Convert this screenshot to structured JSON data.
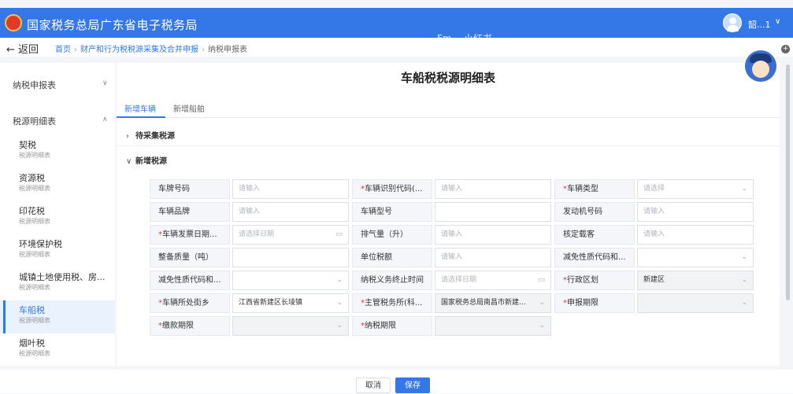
{
  "header": {
    "title": "国家税务总局广东省电子税务局",
    "user": "韶...1",
    "ghost_text": "Fm··· 小红书"
  },
  "nav": {
    "back": "返回",
    "crumbs": [
      "首页",
      "财产和行为税税源采集及合并申报",
      "纳税申报表"
    ]
  },
  "sidebar": {
    "groups": [
      {
        "label": "纳税申报表",
        "chevron": "∨"
      },
      {
        "label": "税源明细表",
        "chevron": "∧"
      }
    ],
    "items": [
      {
        "name": "契税",
        "sub": "税源明细表"
      },
      {
        "name": "资源税",
        "sub": "税源明细表"
      },
      {
        "name": "印花税",
        "sub": "税源明细表"
      },
      {
        "name": "环境保护税",
        "sub": "税源明细表"
      },
      {
        "name": "城镇土地使用税、房...",
        "sub": "税源明细表"
      },
      {
        "name": "车船税",
        "sub": "税源明细表"
      },
      {
        "name": "烟叶税",
        "sub": "税源明细表"
      }
    ]
  },
  "main": {
    "title": "车船税税源明细表",
    "tabs": [
      "新增车辆",
      "新增船舶"
    ],
    "sections": [
      {
        "label": "待采集税源",
        "arrow": "›"
      },
      {
        "label": "新增税源",
        "arrow": "∨"
      }
    ]
  },
  "form": {
    "rows": [
      [
        {
          "label": "车牌号码",
          "req": false,
          "value": "请输入",
          "kind": "input"
        },
        {
          "label": "车辆识别代码(...",
          "req": true,
          "value": "请输入",
          "kind": "input"
        },
        {
          "label": "车辆类型",
          "req": true,
          "value": "请选择",
          "kind": "select"
        }
      ],
      [
        {
          "label": "车辆品牌",
          "req": false,
          "value": "请输入",
          "kind": "input"
        },
        {
          "label": "车辆型号",
          "req": false,
          "value": "",
          "kind": "input"
        },
        {
          "label": "发动机号码",
          "req": false,
          "value": "请输入",
          "kind": "input"
        }
      ],
      [
        {
          "label": "车辆发票日期...",
          "req": true,
          "value": "请选择日期",
          "kind": "date"
        },
        {
          "label": "排气量（升）",
          "req": false,
          "value": "请输入",
          "kind": "input"
        },
        {
          "label": "核定载客",
          "req": false,
          "value": "请输入",
          "kind": "input"
        }
      ],
      [
        {
          "label": "整备质量（吨）",
          "req": false,
          "value": "",
          "kind": "input"
        },
        {
          "label": "单位税额",
          "req": false,
          "value": "请输入",
          "kind": "input"
        },
        {
          "label": "减免性质代码和...",
          "req": false,
          "value": "",
          "kind": "select"
        }
      ],
      [
        {
          "label": "减免性质代码和...",
          "req": false,
          "value": "",
          "kind": "select"
        },
        {
          "label": "纳税义务终止时间",
          "req": false,
          "value": "请选择日期",
          "kind": "date"
        },
        {
          "label": "行政区划",
          "req": true,
          "value": "新建区",
          "kind": "select-dis"
        }
      ],
      [
        {
          "label": "车辆所处街乡",
          "req": true,
          "value": "江西省新建区长堎镇",
          "kind": "select"
        },
        {
          "label": "主管税务所(科...",
          "req": true,
          "value": "国家税务总局南昌市新建...",
          "kind": "select-dis"
        },
        {
          "label": "申报期限",
          "req": true,
          "value": "",
          "kind": "select-dis"
        }
      ],
      [
        {
          "label": "缴款期限",
          "req": true,
          "value": "",
          "kind": "select-dis"
        },
        {
          "label": "纳税期限",
          "req": true,
          "value": "",
          "kind": "select-dis"
        }
      ]
    ]
  },
  "footer": {
    "cancel": "取消",
    "save": "保存"
  },
  "colors": {
    "primary": "#3478e8",
    "required": "#e33333"
  }
}
